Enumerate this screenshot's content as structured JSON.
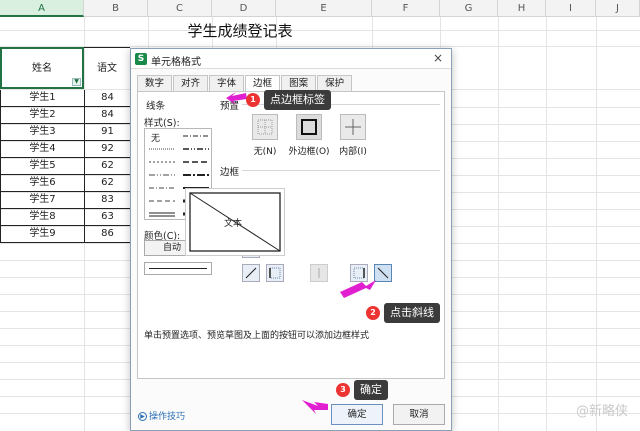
{
  "sheet": {
    "columns": [
      "A",
      "B",
      "C",
      "D",
      "E",
      "F",
      "G",
      "H",
      "I",
      "J"
    ],
    "title": "学生成绩登记表",
    "header_name": "姓名",
    "header_col2": "语文",
    "rows": [
      {
        "name": "学生1",
        "score": "84"
      },
      {
        "name": "学生2",
        "score": "84"
      },
      {
        "name": "学生3",
        "score": "91"
      },
      {
        "name": "学生4",
        "score": "92"
      },
      {
        "name": "学生5",
        "score": "62"
      },
      {
        "name": "学生6",
        "score": "62"
      },
      {
        "name": "学生7",
        "score": "83"
      },
      {
        "name": "学生8",
        "score": "63"
      },
      {
        "name": "学生9",
        "score": "86"
      }
    ]
  },
  "dialog": {
    "app_icon": "S",
    "title": "单元格格式",
    "close": "×",
    "tabs": [
      {
        "label": "数字",
        "active": false
      },
      {
        "label": "对齐",
        "active": false
      },
      {
        "label": "字体",
        "active": false
      },
      {
        "label": "边框",
        "active": true
      },
      {
        "label": "图案",
        "active": false
      },
      {
        "label": "保护",
        "active": false
      }
    ],
    "line_group": "线条",
    "style_label": "样式(S):",
    "none_label": "无",
    "color_label": "颜色(C):",
    "color_value": "自动",
    "preset_group": "预置",
    "presets": [
      {
        "label": "无(N)"
      },
      {
        "label": "外边框(O)"
      },
      {
        "label": "内部(I)"
      }
    ],
    "border_group": "边框",
    "preview_text": "文本",
    "hint": "单击预置选项、预览草图及上面的按钮可以添加边框样式",
    "tips": "操作技巧",
    "ok": "确定",
    "cancel": "取消"
  },
  "annotations": {
    "step1_num": "1",
    "step1_text": "点边框标签",
    "step2_num": "2",
    "step2_text": "点击斜线",
    "step3_num": "3",
    "step3_text": "确定",
    "arrow_color": "#e020d0"
  },
  "watermark": "@新略侠",
  "colors": {
    "excel_green": "#217346",
    "callout_bg": "#3b3b3b",
    "badge_red": "#e33333"
  }
}
